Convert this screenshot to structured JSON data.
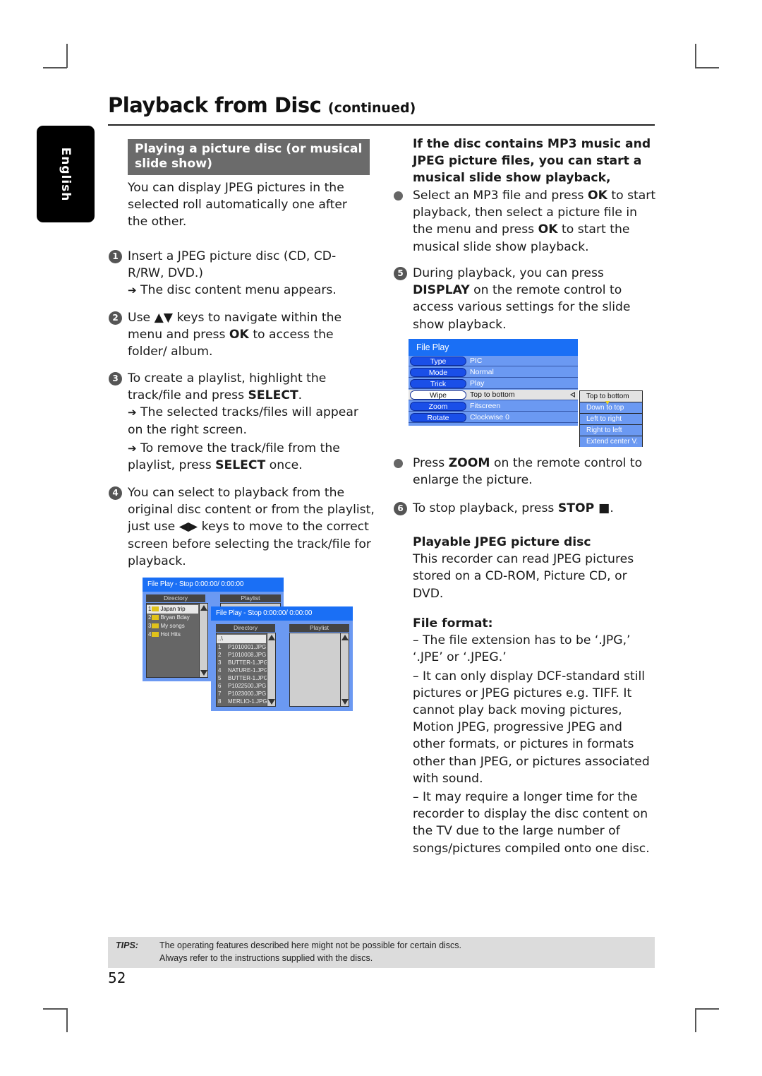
{
  "header": {
    "title": "Playback from Disc",
    "title_suffix": "(continued)",
    "language_tab": "English"
  },
  "left": {
    "section_title": "Playing a picture disc (or musical slide show)",
    "intro": "You can display JPEG pictures in the selected roll automatically one after the other.",
    "steps": [
      {
        "num": "1",
        "text": "Insert a JPEG picture disc (CD, CD-R/RW, DVD.)",
        "results": [
          "The disc content menu appears."
        ]
      },
      {
        "num": "2",
        "text_before": "Use ▲▼ keys to navigate within the menu and press ",
        "key": "OK",
        "text_after": " to access the folder/ album."
      },
      {
        "num": "3",
        "text_before": "To create a playlist, highlight the track/file and press ",
        "key": "SELECT",
        "text_after": ".",
        "result1": "The selected tracks/files will appear on the right screen.",
        "result2_before": "To remove the track/file from the playlist, press ",
        "result2_key": "SELECT",
        "result2_after": " once."
      },
      {
        "num": "4",
        "text": "You can select to playback from the original disc content or from the playlist, just use ◀▶ keys to move to the correct screen before selecting the track/file for playback."
      }
    ],
    "arrow_glyph": "➔"
  },
  "osd_back": {
    "title": "File Play - Stop 0:00:00/ 0:00:00",
    "directory_label": "Directory",
    "playlist_label": "Playlist",
    "folders": [
      {
        "num": "1",
        "name": "Japan trip",
        "selected": true
      },
      {
        "num": "2",
        "name": "Bryan Bday"
      },
      {
        "num": "3",
        "name": "My songs"
      },
      {
        "num": "4",
        "name": "Hot Hits"
      }
    ]
  },
  "osd_front": {
    "title": "File Play - Stop 0:00:00/ 0:00:00",
    "directory_label": "Directory",
    "playlist_label": "Playlist",
    "parent_entry": "..\\",
    "files": [
      {
        "num": "1",
        "name": "P1010001.JPG"
      },
      {
        "num": "2",
        "name": "P1010008.JPG"
      },
      {
        "num": "3",
        "name": "BUTTER-1.JPG"
      },
      {
        "num": "4",
        "name": "NATURE-1.JPG"
      },
      {
        "num": "5",
        "name": "BUTTER-1.JPG"
      },
      {
        "num": "6",
        "name": "P1022500.JPG"
      },
      {
        "num": "7",
        "name": "P1023000.JPG"
      },
      {
        "num": "8",
        "name": "MERLIO-1.JPG"
      }
    ]
  },
  "right": {
    "mp3_heading": "If the disc contains MP3 music and JPEG picture files, you can start a musical slide show playback,",
    "mp3_bullet": {
      "p1": "Select an MP3 file and press ",
      "k1": "OK",
      "p2": " to start playback, then select a picture file in the menu and press ",
      "k2": "OK",
      "p3": " to start the musical slide show playback."
    },
    "step5": {
      "num": "5",
      "p1": "During playback, you can press ",
      "key": "DISPLAY",
      "p2": " on the remote control to access various settings for the slide show playback."
    },
    "zoom_bullet": {
      "p1": "Press ",
      "key": "ZOOM",
      "p2": " on the remote control to enlarge the picture."
    },
    "step6": {
      "num": "6",
      "p1": "To stop playback, press ",
      "key": "STOP ■",
      "p2": "."
    },
    "playable_heading": "Playable JPEG picture disc",
    "playable_text": "This recorder can read JPEG pictures stored on a CD-ROM, Picture CD, or DVD.",
    "format_heading": "File format:",
    "format_items": [
      "–   The file extension has to be ‘.JPG,’ ‘.JPE’ or ‘.JPEG.’",
      "–   It can only display DCF-standard still pictures or JPEG pictures e.g. TIFF. It cannot play back moving pictures, Motion JPEG, progressive JPEG and other formats, or pictures in formats other than JPEG, or pictures associated with sound.",
      "–   It may require a longer time for the recorder to display the disc content on the TV due to the large number of songs/pictures compiled onto one disc."
    ]
  },
  "settings_osd": {
    "title": "File Play",
    "rows": [
      {
        "label": "Type",
        "value": "PIC"
      },
      {
        "label": "Mode",
        "value": "Normal"
      },
      {
        "label": "Trick",
        "value": "Play"
      },
      {
        "label": "Wipe",
        "value": "Top to bottom",
        "active": true
      },
      {
        "label": "Zoom",
        "value": "Fitscreen"
      },
      {
        "label": "Rotate",
        "value": "Clockwise 0"
      }
    ],
    "wipe_options": [
      "Top to bottom",
      "Down to top",
      "Left to right",
      "Right to left",
      "Extend center V."
    ],
    "wipe_selected": 0
  },
  "tips": {
    "label": "TIPS:",
    "line1": "The operating features described here might not be possible for certain discs.",
    "line2": "Always refer to the instructions supplied with the discs."
  },
  "page_number": "52",
  "colors": {
    "osd_title_blue": "#1a6ff5",
    "osd_body_blue": "#6b99f2",
    "section_gray": "#6b6b6b",
    "tips_gray": "#dcdcdc",
    "folder_yellow": "#e0c21a"
  }
}
